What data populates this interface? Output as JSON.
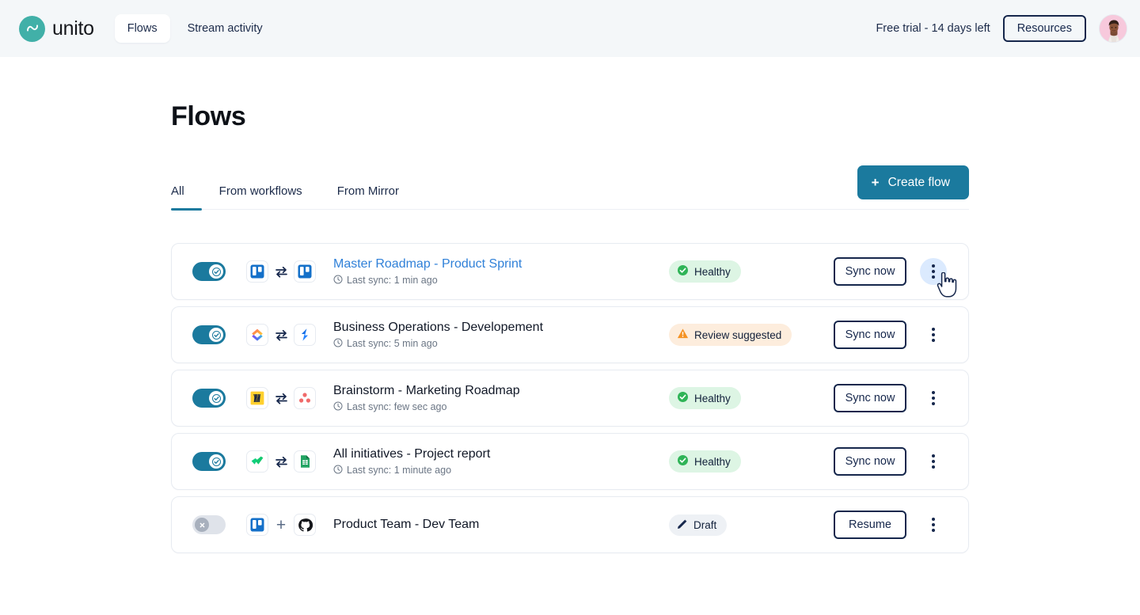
{
  "topbar": {
    "brand_name": "unito",
    "brand_icon": "unito-logo-icon",
    "nav": [
      {
        "label": "Flows",
        "active": true
      },
      {
        "label": "Stream activity",
        "active": false
      }
    ],
    "trial_text": "Free trial - 14 days left",
    "resources_label": "Resources",
    "avatar_alt": "user-avatar"
  },
  "page": {
    "title": "Flows",
    "tabs": [
      {
        "label": "All",
        "active": true
      },
      {
        "label": "From workflows",
        "active": false
      },
      {
        "label": "From Mirror",
        "active": false
      }
    ],
    "create_button": {
      "label": "Create flow",
      "icon": "plus-icon",
      "color": "#1b7a9e"
    }
  },
  "flows": [
    {
      "enabled": true,
      "toggle_state": "on",
      "source_app": "trello",
      "target_app": "trello",
      "connector": "bidirectional-arrows",
      "name": "Master Roadmap - Product Sprint",
      "name_is_link": true,
      "sync_text": "Last sync: 1 min ago",
      "status": {
        "label": "Healthy",
        "type": "healthy",
        "icon": "check-circle-icon"
      },
      "action": {
        "label": "Sync now"
      },
      "menu_hovered": true
    },
    {
      "enabled": true,
      "toggle_state": "on",
      "source_app": "clickup",
      "target_app": "jira",
      "connector": "bidirectional-arrows",
      "name": "Business Operations - Developement",
      "name_is_link": false,
      "sync_text": "Last sync: 5 min ago",
      "status": {
        "label": "Review suggested",
        "type": "review",
        "icon": "warning-triangle-icon"
      },
      "action": {
        "label": "Sync now"
      },
      "menu_hovered": false
    },
    {
      "enabled": true,
      "toggle_state": "on",
      "source_app": "miro",
      "target_app": "asana",
      "connector": "bidirectional-arrows",
      "name": "Brainstorm - Marketing Roadmap",
      "name_is_link": false,
      "sync_text": "Last sync: few sec ago",
      "status": {
        "label": "Healthy",
        "type": "healthy",
        "icon": "check-circle-icon"
      },
      "action": {
        "label": "Sync now"
      },
      "menu_hovered": false
    },
    {
      "enabled": true,
      "toggle_state": "on",
      "source_app": "wrike",
      "target_app": "google-sheets",
      "connector": "bidirectional-arrows",
      "name": "All initiatives - Project report",
      "name_is_link": false,
      "sync_text": "Last sync: 1 minute ago",
      "status": {
        "label": "Healthy",
        "type": "healthy",
        "icon": "check-circle-icon"
      },
      "action": {
        "label": "Sync now"
      },
      "menu_hovered": false
    },
    {
      "enabled": false,
      "toggle_state": "off",
      "source_app": "trello",
      "target_app": "github",
      "connector": "plus",
      "name": "Product Team - Dev Team",
      "name_is_link": false,
      "sync_text": "",
      "status": {
        "label": "Draft",
        "type": "draft",
        "icon": "pencil-icon"
      },
      "action": {
        "label": "Resume"
      },
      "menu_hovered": false
    }
  ],
  "colors": {
    "accent": "#1b7a9e",
    "brand": "#41b0a8",
    "navy": "#16274c",
    "link": "#2f80d8",
    "healthy_bg": "#ddf5e4",
    "healthy_icon": "#2fb457",
    "review_bg": "#fdeddd",
    "review_icon": "#f59223",
    "draft_bg": "#eef1f5",
    "topbar_bg": "#f4f7f9"
  }
}
